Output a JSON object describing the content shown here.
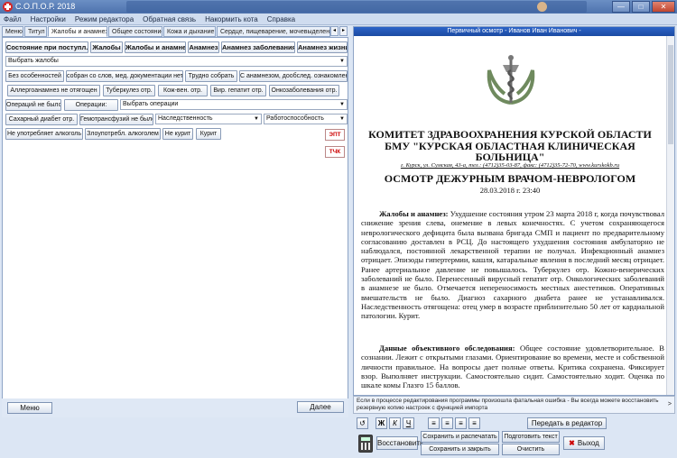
{
  "window": {
    "title": "С.О.П.О.Р. 2018"
  },
  "menu": [
    "Файл",
    "Настройки",
    "Режим редактора",
    "Обратная связь",
    "Накормить кота",
    "Справка"
  ],
  "tabs": [
    "Меню",
    "Титул",
    "Жалобы и анамнез",
    "Общее состояние",
    "Кожа и дыхание",
    "Сердце, пищеварение, мочевыделение"
  ],
  "left": {
    "headers": [
      "Состояние при поступл.",
      "Жалобы",
      "Жалобы и анамнез",
      "Анамнез",
      "Анамнез заболевания",
      "Анамнез жизни"
    ],
    "select_complaints": "Выбрать жалобы",
    "row3": [
      "Без особенностей",
      "собран со слов, мед. документации нет",
      "Трудно собрать",
      "С анамнезом, дообслед. ознакомлен"
    ],
    "row4": [
      "Аллергоанамнез не отягощен",
      "Туберкулез отр.",
      "Кож-вен. отр.",
      "Вир. гепатит отр.",
      "Онкозаболевания отр."
    ],
    "operations_none": "Операций не было",
    "operations_label": "Операции:",
    "select_operations": "Выбрать операции",
    "row6": [
      "Сахарный диабет отр.",
      "Гемотрансфузий не было"
    ],
    "select_heredity": "Наследственность",
    "select_workability": "Работоспособность",
    "row7": [
      "Не употребляет алкоголь",
      "Злоупотребл. алкоголем",
      "Не курит",
      "Курит"
    ],
    "btn_ept": "ЭПТ",
    "btn_tchk": "ТЧК",
    "menu_button": "Меню",
    "next_button": "Далее"
  },
  "right": {
    "header": "Первичный осмотр - Иванов Иван Иванович -",
    "org1": "КОМИТЕТ ЗДРАВООХРАНЕНИЯ КУРСКОЙ ОБЛАСТИ",
    "org2": "БМУ \"КУРСКАЯ ОБЛАСТНАЯ КЛИНИЧЕСКАЯ",
    "org3": "БОЛЬНИЦА\"",
    "address": "г. Курск, ул. Сумская, 43-а, тел.: (4712)35-03-87, факс: (4712)35-72-70, www.kurskokb.ru",
    "exam_title": "ОСМОТР ДЕЖУРНЫМ ВРАЧОМ-НЕВРОЛОГОМ",
    "date": "28.03.2018 г. 23:40",
    "complaints_label": "Жалобы и анамнез:",
    "complaints_text": "Ухудшение состояния утром 23 марта 2018 г, когда почувствовал снижение зрения слева, онемение в левых конечностях. С учетом сохраняющегося неврологического дефицита была вызвана бригада СМП и пациент по предварительному согласованию доставлен в РСЦ. До настоящего ухудшения состояния амбулаторно не наблюдался, постоянной лекарственной терапии не получал. Инфекционный анамнез отрицает. Эпизоды гипертермии, кашля, катаральные явления в последний месяц отрицает. Ранее артериальное давление не повышалось. Туберкулез отр. Кожно-венерических заболеваний не было. Перенесенный вирусный гепатит отр. Онкологических заболеваний в анамнезе не было. Отмечается непереносимость местных анестетиков. Оперативных вмешательств не было. Диагноз сахарного диабета ранее не устанавливался. Наследственность отягощена: отец умер в возрасте приблизительно 50 лет от кардиальной патологии. Курит.",
    "objective_label": "Данные объективного обследования:",
    "objective_text": "Общее состояние удовлетворительное. В сознании. Лежит с открытыми глазами. Ориентирование во времени, месте и собственной личности правильное. На вопросы дает полные ответы. Критика сохранена. Фиксирует взор. Выполняет инструкции. Самостоятельно сидит. Самостоятельно ходит. Оценка по шкале комы Глазго 15 баллов."
  },
  "notice": "Если в процессе редактирования программы произошла фатальная ошибка - Вы всегда можете восстановить резервную копию настроек с функцией импорта",
  "toolbar": {
    "undo": "↺",
    "bold": "Ж",
    "italic": "К",
    "underline": "Ч",
    "send_editor": "Передать в редактор",
    "restore": "Восстановить",
    "save_print": "Сохранить и распечатать",
    "save_close": "Сохранить и закрыть",
    "prepare_text": "Подготовить текст",
    "clear": "Очистить",
    "exit": "Выход"
  }
}
